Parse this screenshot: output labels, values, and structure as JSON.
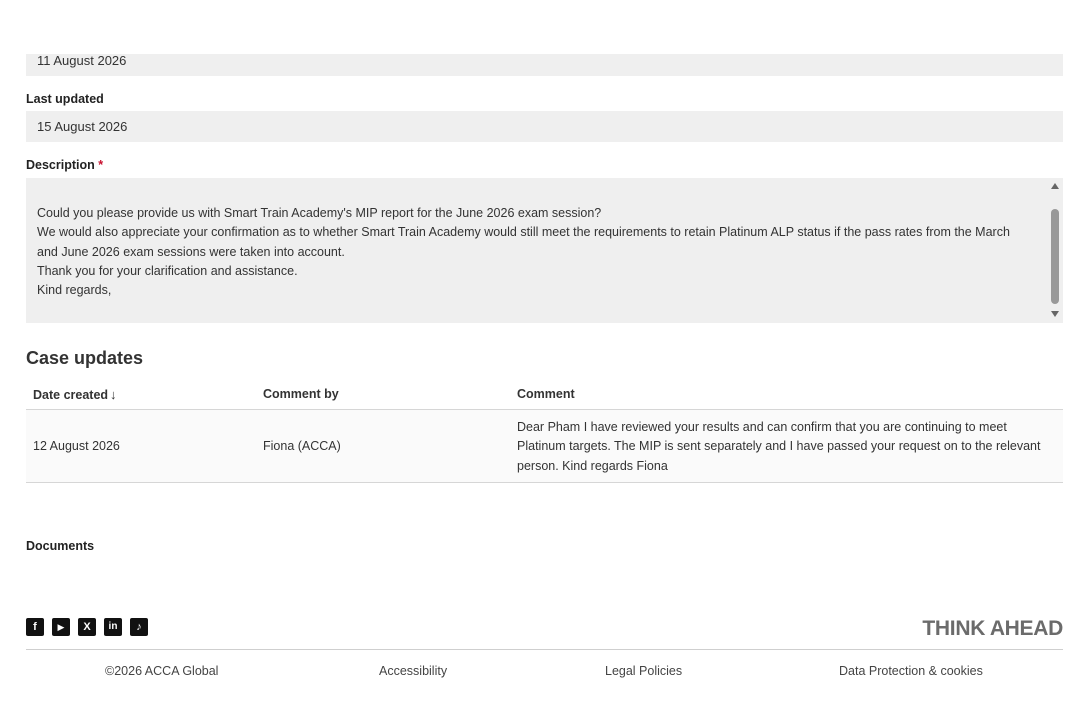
{
  "fields": {
    "created_value": "11 August 2026",
    "last_updated_label": "Last updated",
    "last_updated_value": "15 August 2026",
    "description_label": "Description",
    "description_required": "*",
    "description_lines": [
      "Could you please provide us with Smart Train Academy's MIP report for the June 2026 exam session?",
      "We would also appreciate your confirmation as to whether Smart Train Academy would still meet the requirements to retain Platinum ALP status if the pass rates from the March and June 2026 exam sessions were taken into account.",
      "Thank you for your clarification and assistance.",
      "Kind regards,"
    ]
  },
  "case_updates": {
    "title": "Case updates",
    "columns": {
      "date_created": "Date created",
      "sort_arrow": "↓",
      "comment_by": "Comment by",
      "comment": "Comment"
    },
    "rows": [
      {
        "date": "12 August 2026",
        "by": "Fiona (ACCA)",
        "comment": "Dear Pham I have reviewed your results and can confirm that you are continuing to meet Platinum targets. The MIP is sent separately and I have passed your request on to the relevant person. Kind regards Fiona"
      }
    ]
  },
  "documents": {
    "label": "Documents"
  },
  "footer": {
    "social": [
      {
        "name": "facebook-icon",
        "glyph": "f"
      },
      {
        "name": "youtube-icon",
        "glyph": "▶"
      },
      {
        "name": "x-icon",
        "glyph": "X"
      },
      {
        "name": "linkedin-icon",
        "glyph": "in"
      },
      {
        "name": "tiktok-icon",
        "glyph": "♪"
      }
    ],
    "tagline": "THINK AHEAD",
    "copyright": "©2026 ACCA Global",
    "accessibility": "Accessibility",
    "legal": "Legal Policies",
    "data_protection": "Data Protection & cookies"
  },
  "colors": {
    "field_background": "#efefef",
    "required_star": "#c8102e",
    "tagline": "#6b6b6b"
  }
}
